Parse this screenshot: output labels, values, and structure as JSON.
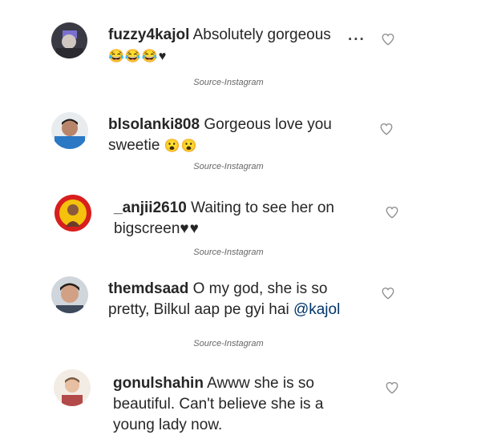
{
  "comments": [
    {
      "username": "fuzzy4kajol",
      "text": "Absolutely gorgeous",
      "more": "...",
      "emoji": "😂😂😂♥"
    },
    {
      "username": "blsolanki808",
      "text": "Gorgeous love you",
      "text2": "sweetie",
      "emoji": "😮😮"
    },
    {
      "username": "_anjii2610",
      "text": "Waiting to see her on",
      "text2": "bigscreen",
      "emoji": "♥♥"
    },
    {
      "username": "themdsaad",
      "text": "O my god, she is so",
      "text2": "pretty, Bilkul aap pe gyi hai",
      "mention": "@kajol"
    },
    {
      "username": "gonulshahin",
      "text": "Awww she is so",
      "text2": "beautiful. Can't believe she is a",
      "text3": "young lady now."
    }
  ],
  "source_label": "Source-Instagram",
  "icons": {
    "like": "heart-outline-icon"
  },
  "colors": {
    "text": "#262626",
    "mention": "#003569",
    "source": "#666666"
  }
}
